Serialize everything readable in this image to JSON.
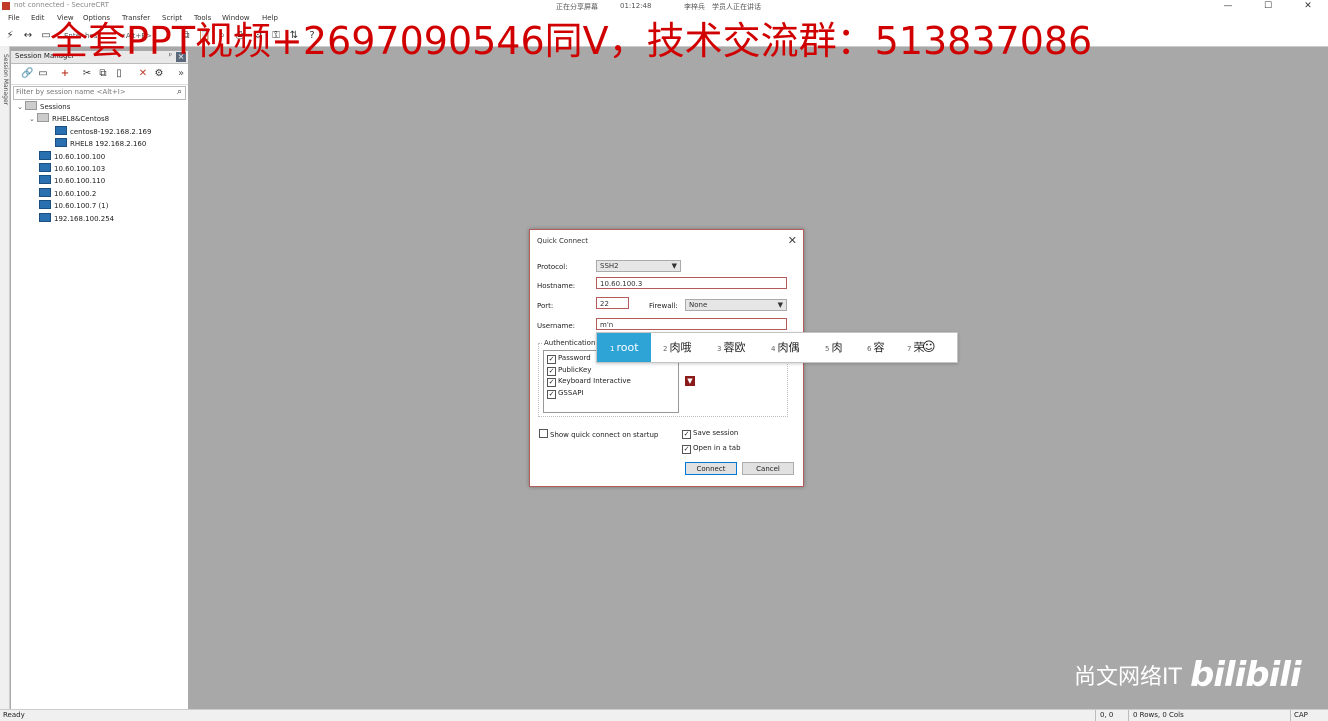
{
  "window": {
    "title": "not connected - SecureCRT",
    "meeting_a": "正在分享屏幕",
    "meeting_b": "01:12:48",
    "meeting_c": "李梓兵",
    "meeting_d": "学员人正在讲话",
    "min": "—",
    "max": "☐",
    "close": "✕"
  },
  "menu": [
    "File",
    "Edit",
    "View",
    "Options",
    "Transfer",
    "Script",
    "Tools",
    "Window",
    "Help"
  ],
  "toolbar": {
    "quick_connect_text": "Enter host",
    "alt_key": "<Alt+R>"
  },
  "watermark": "全套PPT视频+2697090546同V，技术交流群：513837086",
  "side_tabs": {
    "sessions": "Session Manager",
    "command": "Command Manager"
  },
  "session_manager": {
    "title": "Session Manager",
    "pin": "ᵖ",
    "close": "×",
    "filter_placeholder": "Filter by session name <Alt+I>",
    "tree": [
      {
        "label": "Sessions",
        "level": 0,
        "type": "folder",
        "expanded": true
      },
      {
        "label": "RHEL8&Centos8",
        "level": 1,
        "type": "folder",
        "expanded": true
      },
      {
        "label": "centos8-192.168.2.169",
        "level": 2,
        "type": "term"
      },
      {
        "label": "RHEL8 192.168.2.160",
        "level": 2,
        "type": "term"
      },
      {
        "label": "10.60.100.100",
        "level": 1,
        "type": "term"
      },
      {
        "label": "10.60.100.103",
        "level": 1,
        "type": "term"
      },
      {
        "label": "10.60.100.110",
        "level": 1,
        "type": "term"
      },
      {
        "label": "10.60.100.2",
        "level": 1,
        "type": "term"
      },
      {
        "label": "10.60.100.7 (1)",
        "level": 1,
        "type": "term"
      },
      {
        "label": "192.168.100.254",
        "level": 1,
        "type": "term"
      }
    ]
  },
  "dialog": {
    "title": "Quick Connect",
    "close": "✕",
    "protocol_label": "Protocol:",
    "protocol_value": "SSH2",
    "hostname_label": "Hostname:",
    "hostname_value": "10.60.100.3",
    "port_label": "Port:",
    "port_value": "22",
    "firewall_label": "Firewall:",
    "firewall_value": "None",
    "username_label": "Username:",
    "username_value": "m'n",
    "auth_label": "Authentication",
    "auth_methods": [
      {
        "label": "Password",
        "checked": true
      },
      {
        "label": "PublicKey",
        "checked": true
      },
      {
        "label": "Keyboard Interactive",
        "checked": true
      },
      {
        "label": "GSSAPI",
        "checked": true
      }
    ],
    "show_on_startup": "Show quick connect on startup",
    "save_session": "Save session",
    "open_in_tab": "Open in a tab",
    "connect": "Connect",
    "cancel": "Cancel"
  },
  "ime": {
    "candidates": [
      {
        "n": "1",
        "text": "root",
        "selected": true
      },
      {
        "n": "2",
        "text": "肉哦"
      },
      {
        "n": "3",
        "text": "蓉欧"
      },
      {
        "n": "4",
        "text": "肉偶"
      },
      {
        "n": "5",
        "text": "肉"
      },
      {
        "n": "6",
        "text": "容"
      },
      {
        "n": "7",
        "text": "荣"
      }
    ],
    "emoji": "☺"
  },
  "statusbar": {
    "ready": "Ready",
    "pos": "0, 0",
    "size": "0 Rows, 0 Cols",
    "cap": "CAP"
  },
  "corner": {
    "text": "尚文网络IT",
    "logo": "bilibili"
  }
}
